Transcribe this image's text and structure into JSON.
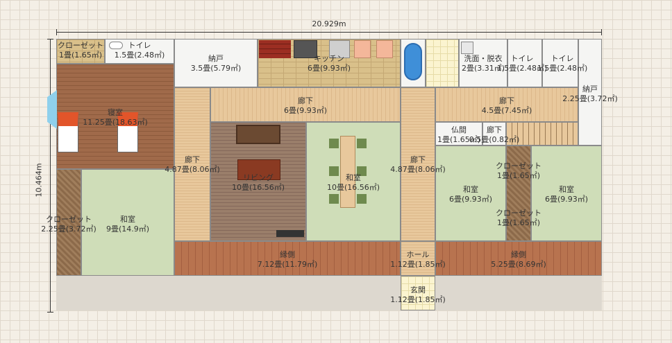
{
  "dimensions": {
    "width": "20.929m",
    "height": "10.464m"
  },
  "rooms": [
    {
      "id": "closet-topleft",
      "name": "クローゼット",
      "area": "1畳(1.65㎡)"
    },
    {
      "id": "toilet-left",
      "name": "トイレ",
      "area": "1.5畳(2.48㎡)"
    },
    {
      "id": "storage-top",
      "name": "納戸",
      "area": "3.5畳(5.79㎡)"
    },
    {
      "id": "kitchen",
      "name": "キッチン",
      "area": "6畳(9.93㎡)"
    },
    {
      "id": "washroom",
      "name": "洗面・脱衣",
      "area": "2畳(3.31㎡)"
    },
    {
      "id": "toilet-right1",
      "name": "トイレ",
      "area": "1.5畳(2.48㎡)"
    },
    {
      "id": "toilet-right2",
      "name": "トイレ",
      "area": "1.5畳(2.48㎡)"
    },
    {
      "id": "storage-right",
      "name": "納戸",
      "area": "2.25畳(3.72㎡)"
    },
    {
      "id": "bedroom",
      "name": "寝室",
      "area": "11.25畳(18.63㎡)"
    },
    {
      "id": "hall-top",
      "name": "廊下",
      "area": "6畳(9.93㎡)"
    },
    {
      "id": "hall-right",
      "name": "廊下",
      "area": "4.5畳(7.45㎡)"
    },
    {
      "id": "butsuma",
      "name": "仏間",
      "area": "1畳(1.65㎡)"
    },
    {
      "id": "hall-small",
      "name": "廊下",
      "area": "0.5畳(0.82㎡)"
    },
    {
      "id": "hall-left",
      "name": "廊下",
      "area": "4.87畳(8.06㎡)"
    },
    {
      "id": "living",
      "name": "リビング",
      "area": "10畳(16.56㎡)"
    },
    {
      "id": "washitsu-center",
      "name": "和室",
      "area": "10畳(16.56㎡)"
    },
    {
      "id": "hall-center",
      "name": "廊下",
      "area": "4.87畳(8.06㎡)"
    },
    {
      "id": "closet-r1",
      "name": "クローゼット",
      "area": "1畳(1.65㎡)"
    },
    {
      "id": "washitsu-r1",
      "name": "和室",
      "area": "6畳(9.93㎡)"
    },
    {
      "id": "washitsu-r2",
      "name": "和室",
      "area": "6畳(9.93㎡)"
    },
    {
      "id": "closet-r2",
      "name": "クローゼット",
      "area": "1畳(1.65㎡)"
    },
    {
      "id": "closet-left",
      "name": "クローゼット",
      "area": "2.25畳(3.72㎡)"
    },
    {
      "id": "washitsu-left",
      "name": "和室",
      "area": "9畳(14.9㎡)"
    },
    {
      "id": "engawa-left",
      "name": "縁側",
      "area": "7.12畳(11.79㎡)"
    },
    {
      "id": "hall-entry",
      "name": "ホール",
      "area": "1.12畳(1.85㎡)"
    },
    {
      "id": "engawa-right",
      "name": "縁側",
      "area": "5.25畳(8.69㎡)"
    },
    {
      "id": "genkan",
      "name": "玄関",
      "area": "1.12畳(1.85㎡)"
    }
  ]
}
